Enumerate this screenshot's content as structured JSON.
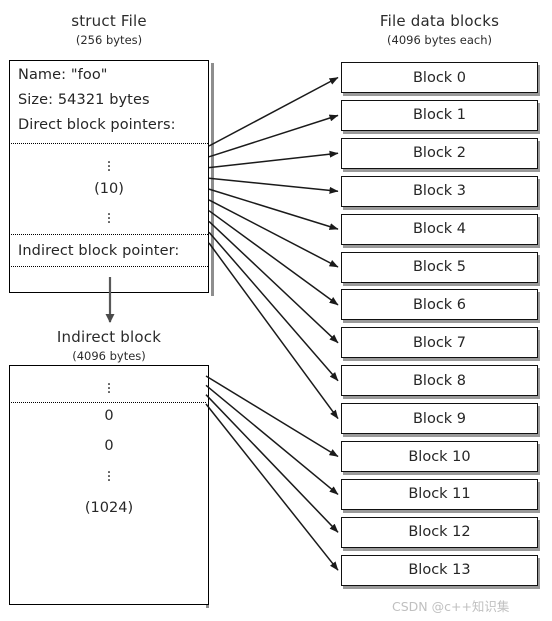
{
  "diagram": {
    "struct_file": {
      "title": "struct File",
      "subtitle": "(256 bytes)",
      "fields": {
        "name": "Name: \"foo\"",
        "size": "Size: 54321 bytes",
        "direct_label": "Direct block pointers:",
        "direct_count": "(10)",
        "indirect_label": "Indirect block pointer:"
      }
    },
    "indirect_block": {
      "title": "Indirect block",
      "subtitle": "(4096 bytes)",
      "entries": {
        "zero_a": "0",
        "zero_b": "0",
        "count": "(1024)"
      }
    },
    "file_data_blocks": {
      "title": "File data blocks",
      "subtitle": "(4096 bytes each)",
      "blocks": [
        "Block 0",
        "Block 1",
        "Block 2",
        "Block 3",
        "Block 4",
        "Block 5",
        "Block 6",
        "Block 7",
        "Block 8",
        "Block 9",
        "Block 10",
        "Block 11",
        "Block 12",
        "Block 13"
      ]
    },
    "watermark": "CSDN @c++知识集",
    "colors": {
      "stroke": "#111111",
      "dotted": "#000000",
      "shadow": "#9a9a9a",
      "text": "#262626",
      "watermark": "#c0c0c0"
    }
  }
}
